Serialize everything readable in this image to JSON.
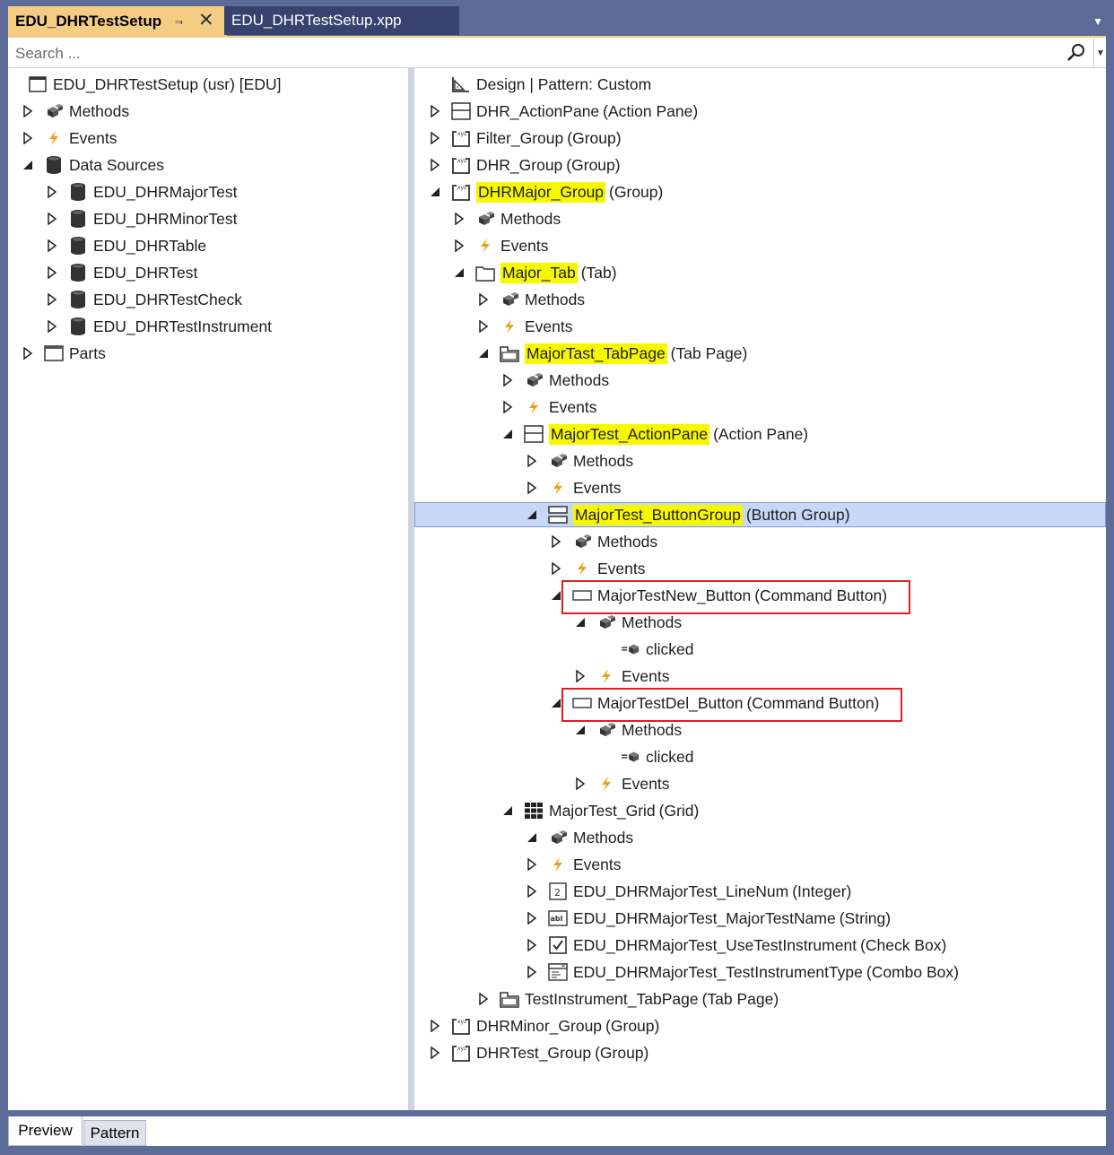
{
  "tabs": [
    {
      "label": "EDU_DHRTestSetup",
      "active": true
    },
    {
      "label": "EDU_DHRTestSetup.xpp",
      "active": false
    }
  ],
  "search": {
    "placeholder": "Search ..."
  },
  "left_tree": [
    {
      "label": "EDU_DHRTestSetup (usr) [EDU]",
      "icon": "form-icon",
      "expander": "none"
    },
    {
      "label": "Methods",
      "icon": "methods-icon",
      "expander": "collapsed"
    },
    {
      "label": "Events",
      "icon": "events-icon",
      "expander": "collapsed"
    },
    {
      "label": "Data Sources",
      "icon": "datasource-icon",
      "expander": "expanded"
    },
    {
      "label": "EDU_DHRMajorTest",
      "icon": "datasource-icon",
      "expander": "collapsed"
    },
    {
      "label": "EDU_DHRMinorTest",
      "icon": "datasource-icon",
      "expander": "collapsed"
    },
    {
      "label": "EDU_DHRTable",
      "icon": "datasource-icon",
      "expander": "collapsed"
    },
    {
      "label": "EDU_DHRTest",
      "icon": "datasource-icon",
      "expander": "collapsed"
    },
    {
      "label": "EDU_DHRTestCheck",
      "icon": "datasource-icon",
      "expander": "collapsed"
    },
    {
      "label": "EDU_DHRTestInstrument",
      "icon": "datasource-icon",
      "expander": "collapsed"
    },
    {
      "label": "Parts",
      "icon": "parts-icon",
      "expander": "collapsed"
    }
  ],
  "right_tree": [
    {
      "name": "Design | Pattern: Custom",
      "type": "",
      "icon": "design-icon",
      "expander": "none",
      "highlight": false
    },
    {
      "name": "DHR_ActionPane",
      "type": "(Action Pane)",
      "icon": "actionpane-icon",
      "expander": "collapsed",
      "highlight": false
    },
    {
      "name": "Filter_Group",
      "type": "(Group)",
      "icon": "group-icon",
      "expander": "collapsed",
      "highlight": false
    },
    {
      "name": "DHR_Group",
      "type": "(Group)",
      "icon": "group-icon",
      "expander": "collapsed",
      "highlight": false
    },
    {
      "name": "DHRMajor_Group",
      "type": "(Group)",
      "icon": "group-icon",
      "expander": "expanded",
      "highlight": true
    },
    {
      "name": "Methods",
      "type": "",
      "icon": "methods-icon",
      "expander": "collapsed",
      "highlight": false
    },
    {
      "name": "Events",
      "type": "",
      "icon": "events-icon",
      "expander": "collapsed",
      "highlight": false
    },
    {
      "name": "Major_Tab",
      "type": "(Tab)",
      "icon": "tab-icon",
      "expander": "expanded",
      "highlight": true
    },
    {
      "name": "Methods",
      "type": "",
      "icon": "methods-icon",
      "expander": "collapsed",
      "highlight": false
    },
    {
      "name": "Events",
      "type": "",
      "icon": "events-icon",
      "expander": "collapsed",
      "highlight": false
    },
    {
      "name": "MajorTast_TabPage",
      "type": "(Tab Page)",
      "icon": "tabpage-icon",
      "expander": "expanded",
      "highlight": true
    },
    {
      "name": "Methods",
      "type": "",
      "icon": "methods-icon",
      "expander": "collapsed",
      "highlight": false
    },
    {
      "name": "Events",
      "type": "",
      "icon": "events-icon",
      "expander": "collapsed",
      "highlight": false
    },
    {
      "name": "MajorTest_ActionPane",
      "type": "(Action Pane)",
      "icon": "actionpane-icon",
      "expander": "expanded",
      "highlight": true
    },
    {
      "name": "Methods",
      "type": "",
      "icon": "methods-icon",
      "expander": "collapsed",
      "highlight": false
    },
    {
      "name": "Events",
      "type": "",
      "icon": "events-icon",
      "expander": "collapsed",
      "highlight": false
    },
    {
      "name": "MajorTest_ButtonGroup",
      "type": "(Button Group)",
      "icon": "buttongroup-icon",
      "expander": "expanded",
      "highlight": true,
      "selected": true
    },
    {
      "name": "Methods",
      "type": "",
      "icon": "methods-icon",
      "expander": "collapsed",
      "highlight": false
    },
    {
      "name": "Events",
      "type": "",
      "icon": "events-icon",
      "expander": "collapsed",
      "highlight": false
    },
    {
      "name": "MajorTestNew_Button",
      "type": "(Command Button)",
      "icon": "button-icon",
      "expander": "expanded",
      "highlight": false,
      "boxed": true
    },
    {
      "name": "Methods",
      "type": "",
      "icon": "methods-icon",
      "expander": "expanded",
      "highlight": false
    },
    {
      "name": "clicked",
      "type": "",
      "icon": "method-item-icon",
      "expander": "none",
      "highlight": false
    },
    {
      "name": "Events",
      "type": "",
      "icon": "events-icon",
      "expander": "collapsed",
      "highlight": false
    },
    {
      "name": "MajorTestDel_Button",
      "type": "(Command Button)",
      "icon": "button-icon",
      "expander": "expanded",
      "highlight": false,
      "boxed": true
    },
    {
      "name": "Methods",
      "type": "",
      "icon": "methods-icon",
      "expander": "expanded",
      "highlight": false
    },
    {
      "name": "clicked",
      "type": "",
      "icon": "method-item-icon",
      "expander": "none",
      "highlight": false
    },
    {
      "name": "Events",
      "type": "",
      "icon": "events-icon",
      "expander": "collapsed",
      "highlight": false
    },
    {
      "name": "MajorTest_Grid",
      "type": "(Grid)",
      "icon": "grid-icon",
      "expander": "expanded",
      "highlight": false
    },
    {
      "name": "Methods",
      "type": "",
      "icon": "methods-icon",
      "expander": "expanded",
      "highlight": false
    },
    {
      "name": "Events",
      "type": "",
      "icon": "events-icon",
      "expander": "collapsed",
      "highlight": false
    },
    {
      "name": "EDU_DHRMajorTest_LineNum",
      "type": "(Integer)",
      "icon": "integer-icon",
      "expander": "collapsed",
      "highlight": false
    },
    {
      "name": "EDU_DHRMajorTest_MajorTestName",
      "type": "(String)",
      "icon": "string-icon",
      "expander": "collapsed",
      "highlight": false
    },
    {
      "name": "EDU_DHRMajorTest_UseTestInstrument",
      "type": "(Check Box)",
      "icon": "checkbox-icon",
      "expander": "collapsed",
      "highlight": false
    },
    {
      "name": "EDU_DHRMajorTest_TestInstrumentType",
      "type": "(Combo Box)",
      "icon": "combobox-icon",
      "expander": "collapsed",
      "highlight": false
    },
    {
      "name": "TestInstrument_TabPage",
      "type": "(Tab Page)",
      "icon": "tabpage-icon",
      "expander": "collapsed",
      "highlight": false
    },
    {
      "name": "DHRMinor_Group",
      "type": "(Group)",
      "icon": "group-icon",
      "expander": "collapsed",
      "highlight": false
    },
    {
      "name": "DHRTest_Group",
      "type": "(Group)",
      "icon": "group-icon",
      "expander": "collapsed",
      "highlight": false
    }
  ],
  "bottom_tabs": [
    {
      "label": "Preview",
      "active": true
    },
    {
      "label": "Pattern",
      "active": false
    }
  ],
  "colors": {
    "highlight": "#f7f700",
    "selection": "#c9d7f7",
    "boxed": "#e0201e",
    "tab_active": "#f5cc84"
  }
}
